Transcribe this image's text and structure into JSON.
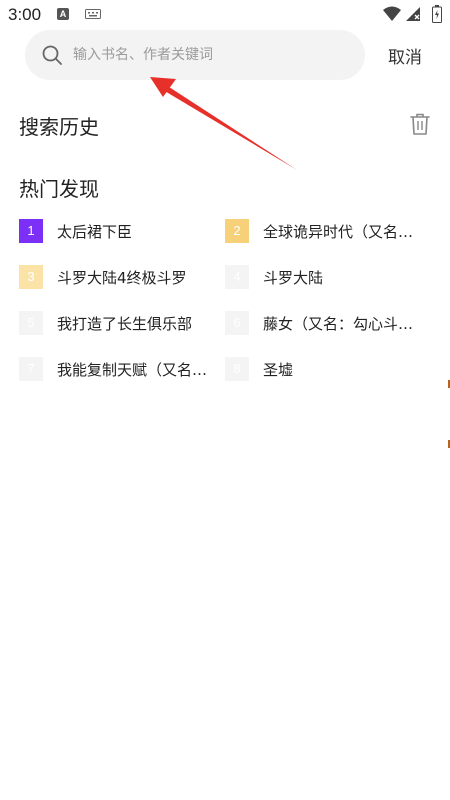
{
  "status_bar": {
    "time": "3:00",
    "a_icon": "A",
    "icons": [
      "a-icon",
      "keyboard-icon",
      "wifi-icon",
      "signal-icon",
      "battery-icon"
    ]
  },
  "search": {
    "placeholder": "输入书名、作者关键词",
    "value": "",
    "cancel_label": "取消"
  },
  "history": {
    "title": "搜索历史",
    "clear_icon": "trash-icon"
  },
  "hot": {
    "title": "热门发现",
    "items": [
      {
        "rank": "1",
        "name": "太后裙下臣",
        "badge_color": "#7b2ff7"
      },
      {
        "rank": "2",
        "name": "全球诡异时代（又名：全球诡异时代）",
        "badge_color": "#f7d07a"
      },
      {
        "rank": "3",
        "name": "斗罗大陆4终极斗罗",
        "badge_color": "#fbe3a8"
      },
      {
        "rank": "4",
        "name": "斗罗大陆",
        "badge_color": "#f4f4f4"
      },
      {
        "rank": "5",
        "name": "我打造了长生俱乐部",
        "badge_color": "#f4f4f4"
      },
      {
        "rank": "6",
        "name": "藤女（又名：勾心斗角）",
        "badge_color": "#f4f4f4"
      },
      {
        "rank": "7",
        "name": "我能复制天赋（又名：我能复制天赋）",
        "badge_color": "#f4f4f4"
      },
      {
        "rank": "8",
        "name": "圣墟",
        "badge_color": "#f4f4f4"
      }
    ]
  },
  "annotation": {
    "arrow_color": "#e8302a"
  }
}
